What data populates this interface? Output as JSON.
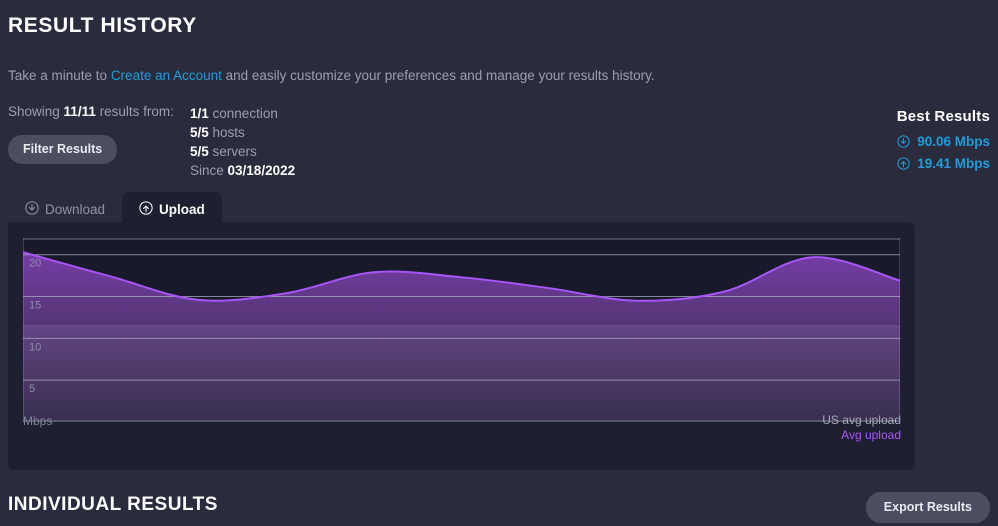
{
  "header": {
    "title": "RESULT HISTORY",
    "intro_before": "Take a minute to ",
    "intro_link": "Create an Account",
    "intro_after": " and easily customize your preferences and manage your results history."
  },
  "showing": {
    "prefix": "Showing ",
    "count": "11/11",
    "suffix": " results from:",
    "filter_button": "Filter Results",
    "facets": [
      {
        "value": "1/1",
        "label": " connection"
      },
      {
        "value": "5/5",
        "label": " hosts"
      },
      {
        "value": "5/5",
        "label": " servers"
      }
    ],
    "since_label": "Since ",
    "since_value": "03/18/2022"
  },
  "best_results": {
    "title": "Best Results",
    "download_icon": "download-circle-icon",
    "download_value": "90.06 Mbps",
    "upload_icon": "upload-circle-icon",
    "upload_value": "19.41 Mbps",
    "accent_color": "#1f9dd9"
  },
  "tabs": [
    {
      "label": "Download",
      "icon": "download-circle-icon",
      "active": false
    },
    {
      "label": "Upload",
      "icon": "upload-circle-icon",
      "active": true
    }
  ],
  "chart_legend": {
    "us_avg": "US avg upload",
    "avg": "Avg upload",
    "avg_color": "#a855f7"
  },
  "axis": {
    "unit": "Mbps"
  },
  "footer": {
    "section_title": "INDIVIDUAL RESULTS",
    "export_button": "Export Results"
  },
  "chart_data": {
    "type": "area",
    "title": "",
    "xlabel": "",
    "ylabel": "Mbps",
    "ylim": [
      0,
      22
    ],
    "yticks": [
      5,
      10,
      15,
      20
    ],
    "grid": true,
    "legend_position": "bottom-right",
    "series": [
      {
        "name": "Avg upload",
        "color": "#a855f7",
        "fill": "area-gradient-purple",
        "x": [
          0,
          1,
          2,
          3,
          4,
          5,
          6,
          7,
          8,
          9,
          10
        ],
        "values": [
          20.3,
          17.4,
          14.6,
          15.4,
          17.9,
          17.3,
          16.0,
          14.5,
          15.6,
          19.7,
          16.9
        ]
      },
      {
        "name": "US avg upload",
        "color": "#9a9cb5",
        "type": "band",
        "value": 11.5
      }
    ]
  }
}
